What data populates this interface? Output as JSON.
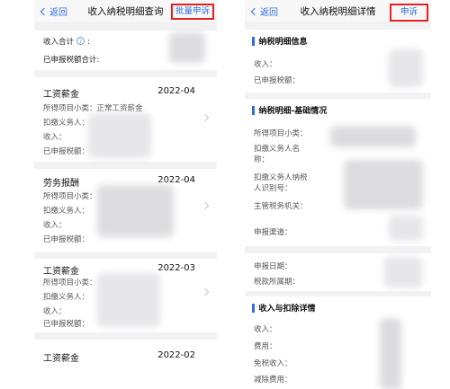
{
  "left_screen": {
    "back_label": "返回",
    "title": "收入纳税明细查询",
    "action_label": "批量申诉",
    "summary": {
      "income_total_label": "收入合计",
      "help_icon": "?",
      "income_total_colon": ":",
      "tax_paid_total_label": "已申报税额合计:"
    },
    "records": [
      {
        "title": "工资薪金",
        "date": "2022-04",
        "subcategory": "所得项目小类：正常工资薪金",
        "withholder": "扣缴义务人：",
        "income": "收入：",
        "tax_paid": "已申报税额："
      },
      {
        "title": "劳务报酬",
        "date": "2022-04",
        "subcategory": "所得项目小类：",
        "withholder": "扣缴义务人：",
        "income": "收入：",
        "tax_paid": "已申报税额："
      },
      {
        "title": "工资薪金",
        "date": "2022-03",
        "subcategory": "所得项目小类：",
        "withholder": "扣缴义务人：",
        "income": "收入：",
        "tax_paid": "已申报税额："
      },
      {
        "title": "工资薪金",
        "date": "2022-02"
      }
    ]
  },
  "right_screen": {
    "back_label": "返回",
    "title": "收入纳税明细详情",
    "action_label": "申诉",
    "section1": {
      "heading": "纳税明细信息",
      "income": "收入：",
      "tax_paid": "已申报税额："
    },
    "section2": {
      "heading": "纳税明细-基础情况",
      "subcategory": "所得项目小类：",
      "withholder_name_1": "扣缴义务人名",
      "withholder_name_2": "称：",
      "withholder_id_1": "扣缴义务人纳税",
      "withholder_id_2": "人识别号：",
      "tax_authority": "主管税务机关：",
      "channel": "申报渠道：",
      "filing_date": "申报日期：",
      "tax_period": "税款所属期："
    },
    "section3": {
      "heading": "收入与扣除详情",
      "income": "收入：",
      "expenses": "费用：",
      "tax_free_income": "免税收入：",
      "deduction": "减除费用："
    }
  },
  "colors": {
    "accent_blue": "#2f6fe0",
    "highlight_red": "#e52020",
    "page_gray": "#f2f2f4"
  }
}
